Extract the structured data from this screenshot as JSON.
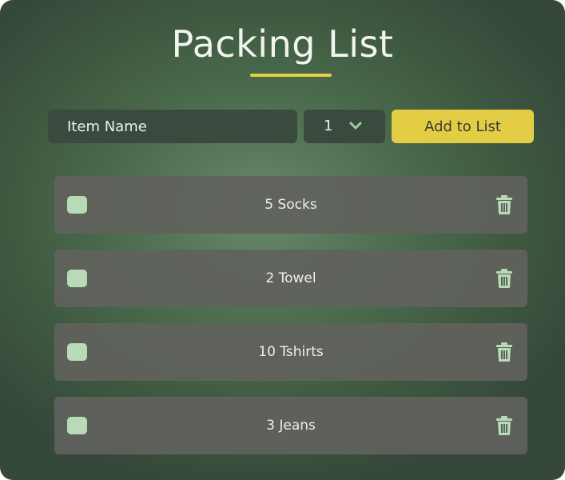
{
  "header": {
    "title": "Packing List"
  },
  "form": {
    "item_placeholder": "Item Name",
    "quantity_selected": "1",
    "add_button_label": "Add to List"
  },
  "items": [
    {
      "label": "5 Socks",
      "checked": false
    },
    {
      "label": "2 Towel",
      "checked": false
    },
    {
      "label": "10 Tshirts",
      "checked": false
    },
    {
      "label": "3 Jeans",
      "checked": false
    }
  ],
  "colors": {
    "accent": "#e3cd44",
    "checkbox": "#b7dbb7",
    "icon": "#b7dbb7"
  },
  "icons": {
    "dropdown": "chevron-down-icon",
    "delete": "trash-icon"
  }
}
